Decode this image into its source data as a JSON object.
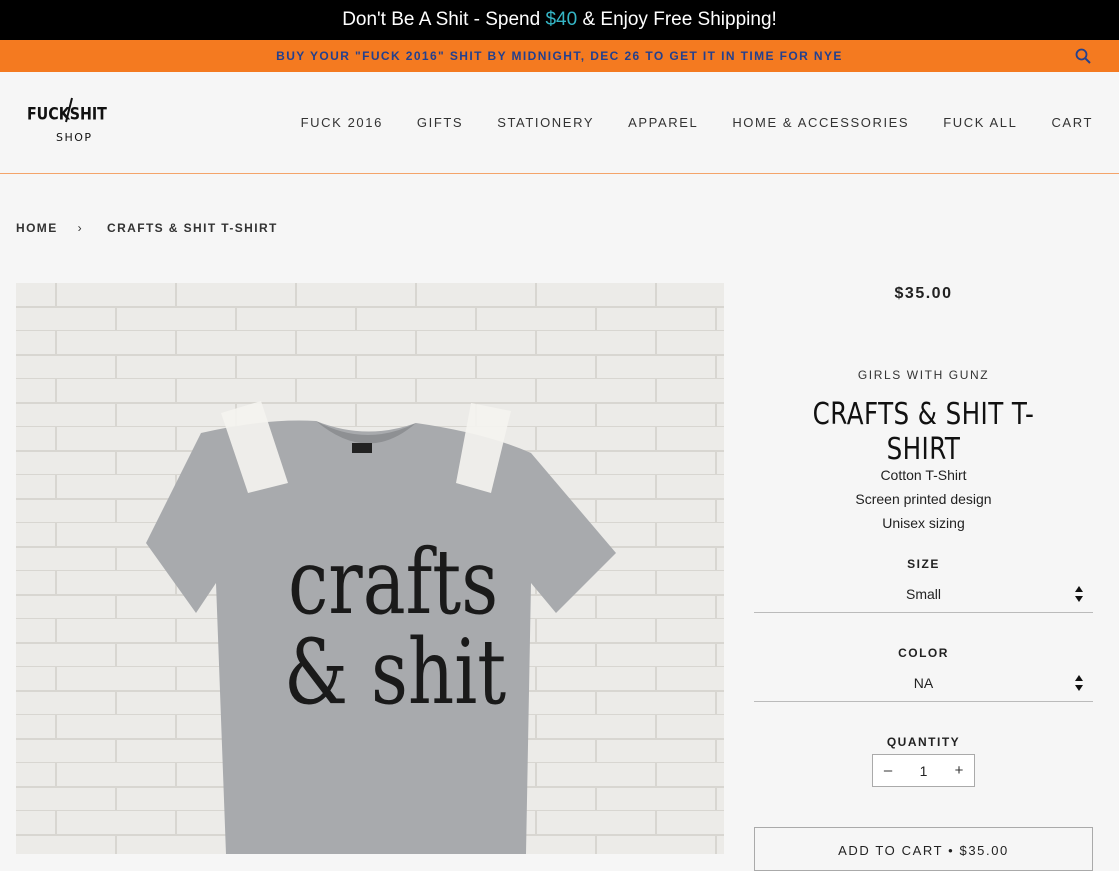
{
  "announcement": {
    "prefix": "Don't Be A Shit - Spend ",
    "amount": "$40",
    "suffix": " & Enjoy Free Shipping!"
  },
  "promo": {
    "message": "BUY YOUR \"FUCK 2016\" SHIT BY MIDNIGHT, DEC 26 TO GET IT IN TIME FOR NYE"
  },
  "logo": {
    "line1": "FUCK",
    "line2": "SHIT",
    "line3": "SHOP"
  },
  "nav": {
    "items": [
      "FUCK 2016",
      "GIFTS",
      "STATIONERY",
      "APPAREL",
      "HOME & ACCESSORIES",
      "FUCK ALL",
      "CART"
    ]
  },
  "breadcrumb": {
    "home": "HOME",
    "separator": "›",
    "current": "CRAFTS & SHIT T-SHIRT"
  },
  "product": {
    "print_line1": "crafts",
    "print_line2": "& shit",
    "price": "$35.00",
    "vendor": "GIRLS WITH GUNZ",
    "title": "CRAFTS & SHIT T-SHIRT",
    "description": [
      "Cotton T-Shirt",
      "Screen printed design",
      "Unisex sizing"
    ],
    "size_label": "SIZE",
    "size_value": "Small",
    "color_label": "COLOR",
    "color_value": "NA",
    "quantity_label": "QUANTITY",
    "quantity_minus": "–",
    "quantity_value": "1",
    "quantity_plus": "+",
    "add_to_cart": "ADD TO CART • $35.00"
  },
  "colors": {
    "top_bar": "#000000",
    "accent": "#35b6c6",
    "orange_bar": "#f47a20",
    "promo_text": "#23408e"
  }
}
